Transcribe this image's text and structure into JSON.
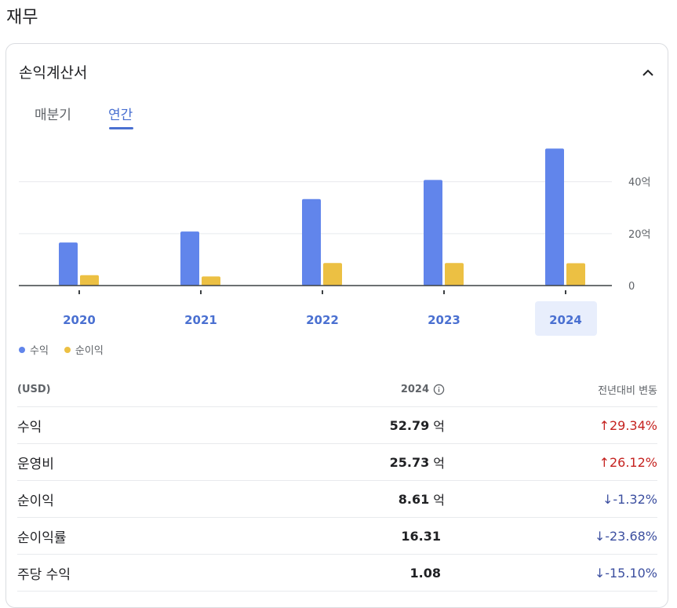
{
  "page_title": "재무",
  "card_title": "손익계산서",
  "tabs": [
    {
      "label": "매분기",
      "active": false
    },
    {
      "label": "연간",
      "active": true
    }
  ],
  "colors": {
    "revenue": "#6185eb",
    "net_income": "#ecc043",
    "accent": "#4a70d1",
    "up": "#c5221f",
    "down": "#3c4fa0"
  },
  "chart_data": {
    "type": "bar",
    "categories": [
      "2020",
      "2021",
      "2022",
      "2023",
      "2024"
    ],
    "selected_category": "2024",
    "series": [
      {
        "name": "수익",
        "values": [
          16.6,
          20.8,
          33.3,
          40.7,
          52.79
        ]
      },
      {
        "name": "순이익",
        "values": [
          4.0,
          3.5,
          8.7,
          8.7,
          8.61
        ]
      }
    ],
    "y_ticks": [
      "0",
      "20억",
      "40억"
    ],
    "y_tick_values": [
      0,
      20,
      40
    ],
    "ylim": [
      0,
      55
    ],
    "grid": true
  },
  "legend": [
    {
      "label": "수익",
      "color": "#6185eb"
    },
    {
      "label": "순이익",
      "color": "#ecc043"
    }
  ],
  "table": {
    "headers": {
      "currency": "(USD)",
      "period": "2024",
      "change": "전년대비 변동"
    },
    "rows": [
      {
        "label": "수익",
        "value": "52.79",
        "unit": "억",
        "change": "29.34%",
        "direction": "up",
        "arrow": "↑"
      },
      {
        "label": "운영비",
        "value": "25.73",
        "unit": "억",
        "change": "26.12%",
        "direction": "up",
        "arrow": "↑"
      },
      {
        "label": "순이익",
        "value": "8.61",
        "unit": "억",
        "change": "-1.32%",
        "direction": "down",
        "arrow": "↓"
      },
      {
        "label": "순이익률",
        "value": "16.31",
        "unit": "",
        "change": "-23.68%",
        "direction": "down",
        "arrow": "↓"
      },
      {
        "label": "주당 수익",
        "value": "1.08",
        "unit": "",
        "change": "-15.10%",
        "direction": "down",
        "arrow": "↓"
      }
    ]
  }
}
